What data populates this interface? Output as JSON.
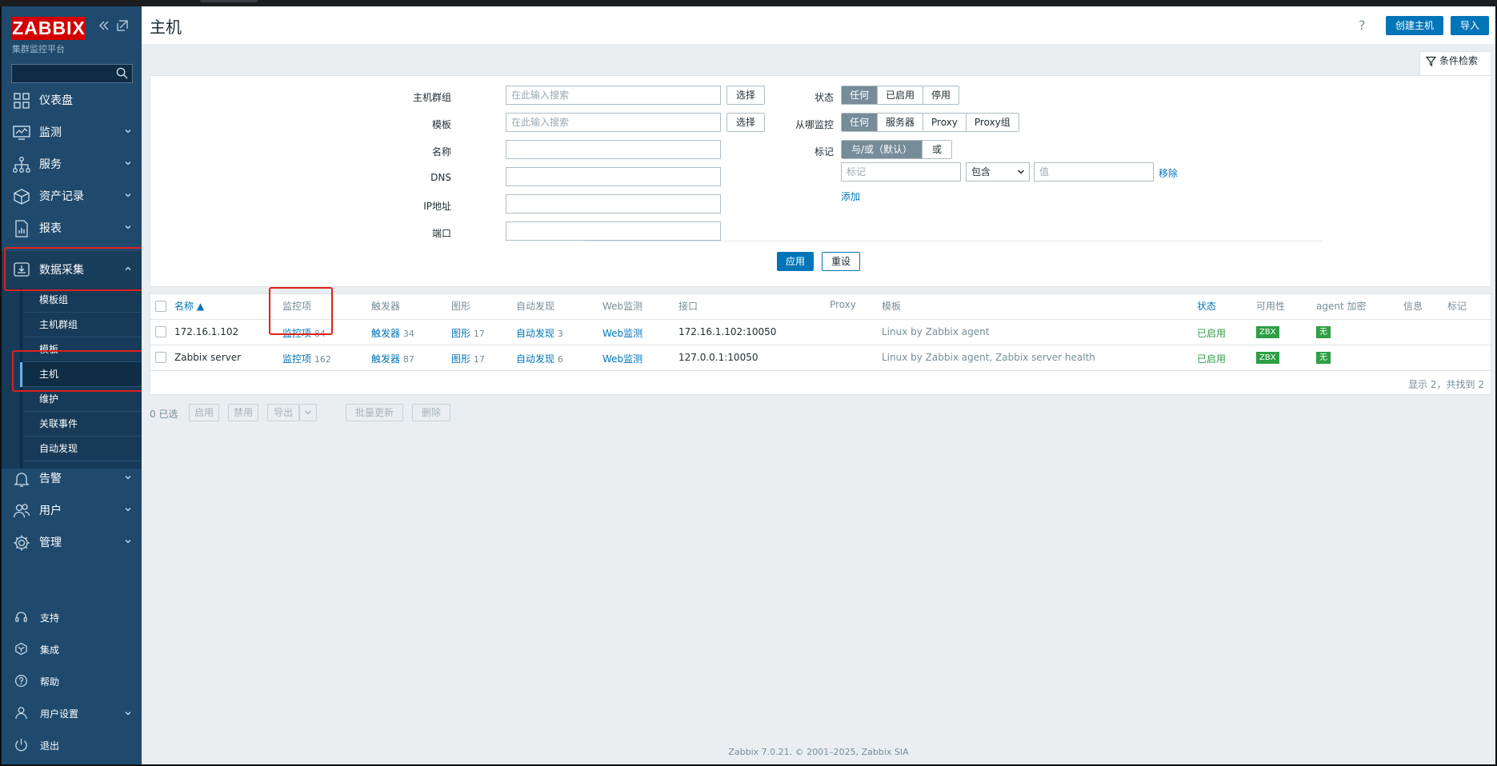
{
  "app": {
    "logo": "ZABBIX",
    "subtitle": "集群监控平台"
  },
  "sidebar": {
    "search_placeholder": "",
    "nav": [
      {
        "label": "仪表盘",
        "icon": "dashboard-icon",
        "has_chevron": false
      },
      {
        "label": "监测",
        "icon": "monitoring-icon",
        "has_chevron": true
      },
      {
        "label": "服务",
        "icon": "services-icon",
        "has_chevron": true
      },
      {
        "label": "资产记录",
        "icon": "inventory-icon",
        "has_chevron": true
      },
      {
        "label": "报表",
        "icon": "reports-icon",
        "has_chevron": true
      },
      {
        "label": "数据采集",
        "icon": "data-collection-icon",
        "has_chevron": true
      },
      {
        "label": "告警",
        "icon": "alerts-icon",
        "has_chevron": true
      },
      {
        "label": "用户",
        "icon": "users-icon",
        "has_chevron": true
      },
      {
        "label": "管理",
        "icon": "admin-gear-icon",
        "has_chevron": true
      }
    ],
    "submenu": [
      "模板组",
      "主机群组",
      "模板",
      "主机",
      "维护",
      "关联事件",
      "自动发现"
    ],
    "bottom": [
      {
        "label": "支持",
        "icon": "headset-icon"
      },
      {
        "label": "集成",
        "icon": "integrations-icon"
      },
      {
        "label": "帮助",
        "icon": "help-icon"
      },
      {
        "label": "用户设置",
        "icon": "user-settings-icon"
      },
      {
        "label": "退出",
        "icon": "signout-icon"
      }
    ]
  },
  "header": {
    "title": "主机",
    "help": "?",
    "create_button": "创建主机",
    "import_button": "导入"
  },
  "filter": {
    "tab_label": "条件检索",
    "host_groups_label": "主机群组",
    "host_groups_placeholder": "在此输入搜索",
    "templates_label": "模板",
    "templates_placeholder": "在此输入搜索",
    "select_button": "选择",
    "name_label": "名称",
    "dns_label": "DNS",
    "ip_label": "IP地址",
    "port_label": "端口",
    "status_label": "状态",
    "status_options": [
      "任何",
      "已启用",
      "停用"
    ],
    "monitored_by_label": "从哪监控",
    "monitored_by_options": [
      "任何",
      "服务器",
      "Proxy",
      "Proxy组"
    ],
    "tags_label": "标记",
    "tags_mode_options": [
      "与/或（默认）",
      "或"
    ],
    "tag_placeholder": "标记",
    "tag_operator": "包含",
    "value_placeholder": "值",
    "remove_link": "移除",
    "add_link": "添加",
    "apply_button": "应用",
    "reset_button": "重设"
  },
  "table": {
    "headers": [
      "名称 ▲",
      "监控项",
      "触发器",
      "图形",
      "自动发现",
      "Web监测",
      "接口",
      "Proxy",
      "模板",
      "状态",
      "可用性",
      "agent 加密",
      "信息",
      "标记"
    ],
    "rows": [
      {
        "name": "172.16.1.102",
        "items": "监控项",
        "items_count": "84",
        "triggers": "触发器",
        "triggers_count": "34",
        "graphs": "图形",
        "graphs_count": "17",
        "discovery": "自动发现",
        "discovery_count": "3",
        "web": "Web监测",
        "interface": "172.16.1.102:10050",
        "proxy": "",
        "templates": "Linux by Zabbix agent",
        "status": "已启用",
        "availability": "ZBX",
        "encryption": "无"
      },
      {
        "name": "Zabbix server",
        "items": "监控项",
        "items_count": "162",
        "triggers": "触发器",
        "triggers_count": "87",
        "graphs": "图形",
        "graphs_count": "17",
        "discovery": "自动发现",
        "discovery_count": "6",
        "web": "Web监测",
        "interface": "127.0.0.1:10050",
        "proxy": "",
        "templates": "Linux by Zabbix agent, Zabbix server health",
        "status": "已启用",
        "availability": "ZBX",
        "encryption": "无"
      }
    ],
    "summary": "显示 2，共找到 2"
  },
  "actions": {
    "selected": "0 已选",
    "enable": "启用",
    "disable": "禁用",
    "export": "导出",
    "mass_update": "批量更新",
    "delete": "删除"
  },
  "footer": "Zabbix 7.0.21. © 2001–2025, Zabbix SIA",
  "colors": {
    "sidebar": "#1f4a6e",
    "accent": "#0275b8",
    "logo_red": "#d40000",
    "status_green": "#2e9f44",
    "highlight_red": "#e0201a"
  }
}
